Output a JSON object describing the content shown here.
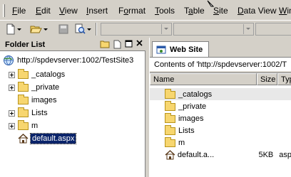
{
  "menubar": {
    "items": [
      "File",
      "Edit",
      "View",
      "Insert",
      "Format",
      "Tools",
      "Table",
      "Site",
      "Data View",
      "Win"
    ],
    "underlines": [
      "F",
      "E",
      "V",
      "I",
      "o",
      "T",
      "a",
      "S",
      "D",
      "W"
    ]
  },
  "colors": {
    "chrome": "#d4d0c8",
    "selection": "#0a246a",
    "folder": "#f7d66f"
  },
  "folder_list": {
    "title": "Folder List",
    "root": "http://spdevserver:1002/TestSite3",
    "items": [
      {
        "label": "_catalogs",
        "expandable": true,
        "icon": "folder-icon"
      },
      {
        "label": "_private",
        "expandable": true,
        "icon": "folder-icon"
      },
      {
        "label": "images",
        "expandable": false,
        "icon": "folder-icon"
      },
      {
        "label": "Lists",
        "expandable": true,
        "icon": "folder-icon"
      },
      {
        "label": "m",
        "expandable": true,
        "icon": "folder-icon"
      },
      {
        "label": "default.aspx",
        "expandable": false,
        "icon": "home-page-icon",
        "selected": true
      }
    ]
  },
  "web_site": {
    "tab_label": "Web Site",
    "contents_text": "Contents of 'http://spdevserver:1002/T",
    "columns": {
      "name": "Name",
      "size": "Size",
      "type": "Typ"
    },
    "rows": [
      {
        "name": "_catalogs",
        "size": "",
        "type": "",
        "icon": "folder-icon",
        "highlight": true
      },
      {
        "name": "_private",
        "size": "",
        "type": "",
        "icon": "folder-icon"
      },
      {
        "name": "images",
        "size": "",
        "type": "",
        "icon": "folder-icon"
      },
      {
        "name": "Lists",
        "size": "",
        "type": "",
        "icon": "folder-icon"
      },
      {
        "name": "m",
        "size": "",
        "type": "",
        "icon": "folder-icon"
      },
      {
        "name": "default.a...",
        "size": "5KB",
        "type": "asp",
        "icon": "home-page-icon"
      }
    ]
  }
}
